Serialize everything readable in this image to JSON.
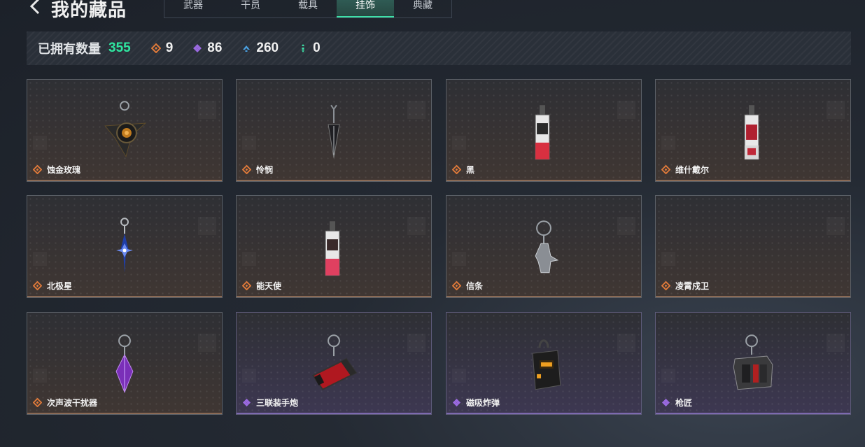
{
  "header": {
    "title": "我的藏品",
    "tabs": [
      {
        "label": "武器",
        "active": false
      },
      {
        "label": "干员",
        "active": false
      },
      {
        "label": "载具",
        "active": false
      },
      {
        "label": "挂饰",
        "active": true
      },
      {
        "label": "典藏",
        "active": false
      }
    ]
  },
  "summary": {
    "label": "已拥有数量",
    "total": "355",
    "rarities": [
      {
        "icon": "orange-diamond-icon",
        "color": "#e07a3a",
        "count": "9"
      },
      {
        "icon": "purple-diamond-icon",
        "color": "#9a6ae0",
        "count": "86"
      },
      {
        "icon": "blue-chevron-icon",
        "color": "#4aa0e0",
        "count": "260"
      },
      {
        "icon": "green-dots-icon",
        "color": "#3ee0a8",
        "count": "0"
      }
    ]
  },
  "items": [
    {
      "name": "蚀金玫瑰",
      "rarity": "orange",
      "charm": "rose"
    },
    {
      "name": "怜悯",
      "rarity": "orange",
      "charm": "dagger"
    },
    {
      "name": "黑",
      "rarity": "orange",
      "charm": "card"
    },
    {
      "name": "维什戴尔",
      "rarity": "orange",
      "charm": "card"
    },
    {
      "name": "北极星",
      "rarity": "orange",
      "charm": "star"
    },
    {
      "name": "能天使",
      "rarity": "orange",
      "charm": "card"
    },
    {
      "name": "信条",
      "rarity": "orange",
      "charm": "statue"
    },
    {
      "name": "凌霄戍卫",
      "rarity": "orange",
      "charm": "none"
    },
    {
      "name": "次声波干扰器",
      "rarity": "orange",
      "charm": "crystal"
    },
    {
      "name": "三联装手炮",
      "rarity": "purple",
      "charm": "cannon"
    },
    {
      "name": "磁吸炸弹",
      "rarity": "purple",
      "charm": "bomb"
    },
    {
      "name": "枪匠",
      "rarity": "purple",
      "charm": "toolbox"
    }
  ],
  "colors": {
    "accent_green": "#3ee0a8",
    "orange_rarity": "#e07a3a",
    "purple_rarity": "#9a6ae0"
  }
}
